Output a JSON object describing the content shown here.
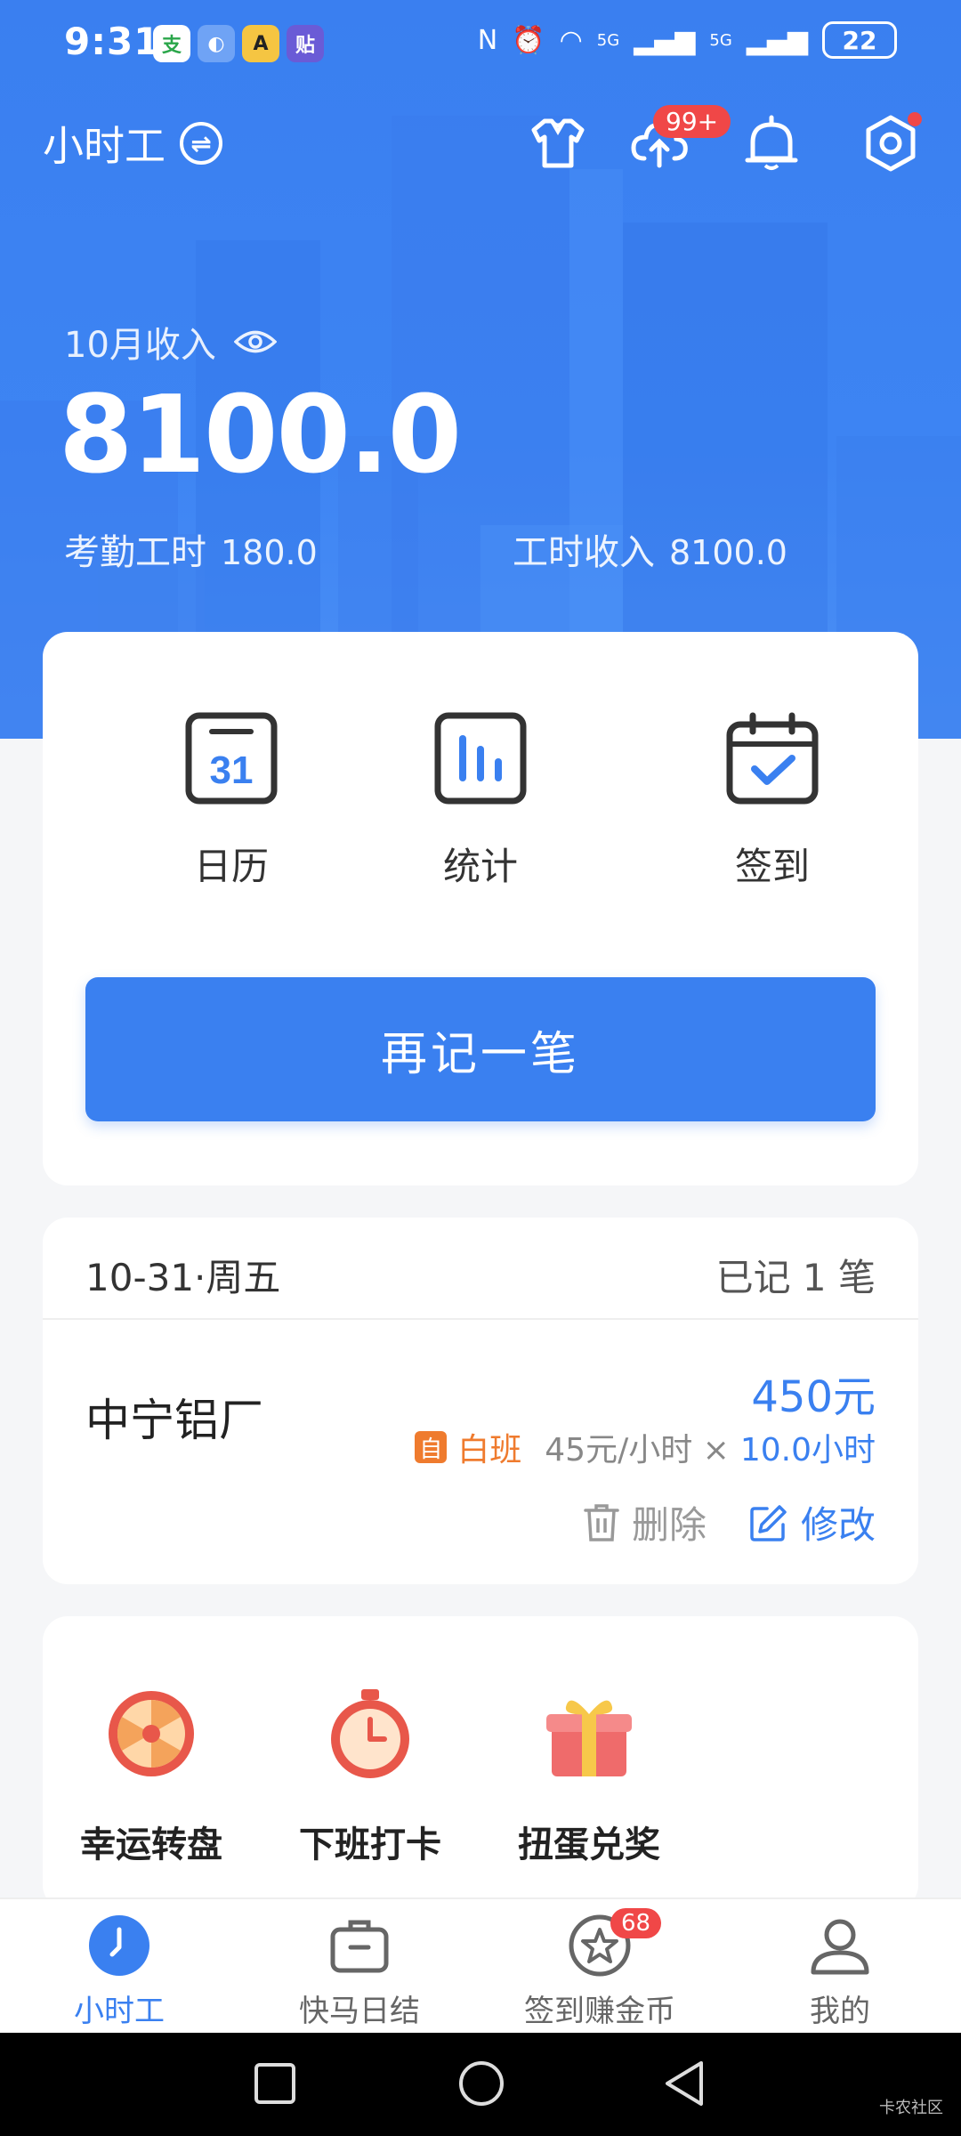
{
  "status_bar": {
    "time": "9:31",
    "notification_apps": [
      "支",
      "◐",
      "A",
      "贴"
    ],
    "signal_1": "5G",
    "signal_2": "5G",
    "battery": "22"
  },
  "header": {
    "app_title": "小时工",
    "upload_badge": "99+",
    "month_label": "10月收入",
    "month_income": "8100.0",
    "attendance_label": "考勤工时",
    "attendance_value": "180.0",
    "hourly_income_label": "工时收入",
    "hourly_income_value": "8100.0"
  },
  "quick_actions": {
    "calendar_label": "日历",
    "calendar_day": "31",
    "stats_label": "统计",
    "checkin_label": "签到",
    "add_record_button": "再记一笔"
  },
  "record": {
    "date": "10-31·周五",
    "count": "已记 1 笔",
    "company": "中宁铝厂",
    "amount": "450元",
    "tag": "自",
    "shift": "白班",
    "rate": "45元/小时 ×",
    "hours": "10.0小时",
    "delete_label": "删除",
    "edit_label": "修改"
  },
  "promos": {
    "wheel": "幸运转盘",
    "clock_out": "下班打卡",
    "gacha": "扭蛋兑奖"
  },
  "tabs": {
    "hourly": "小时工",
    "daily": "快马日结",
    "coins": "签到赚金币",
    "coins_badge": "68",
    "mine": "我的"
  },
  "watermark": "卡农社区",
  "colors": {
    "primary": "#3a80f0",
    "badge_red": "#f04747",
    "shift_orange": "#ef7b2e"
  }
}
